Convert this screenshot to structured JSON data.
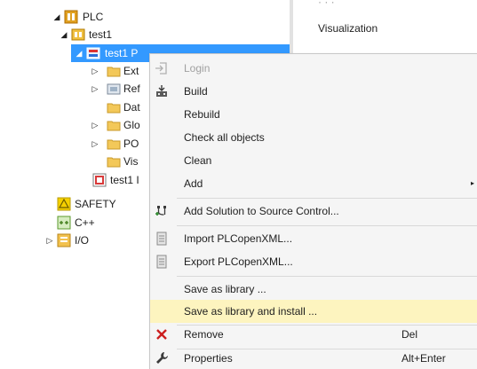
{
  "colors": {
    "selection": "#3399ff",
    "menu_background": "#f5f5f5",
    "menu_highlight": "#fdf4bf",
    "disabled_text": "#a0a0a0",
    "remove_icon": "#cc1f1f"
  },
  "tree": {
    "nodes": [
      {
        "label": "PLC",
        "icon": "plc-folder-icon",
        "expanded": true
      },
      {
        "label": "test1",
        "icon": "plc-project-icon",
        "expanded": true
      },
      {
        "label": "test1 P",
        "icon": "plc-project-node-icon",
        "expanded": true,
        "selected": true
      },
      {
        "label": "Ext",
        "icon": "folder-icon",
        "expanded": false
      },
      {
        "label": "Ref",
        "icon": "references-icon",
        "expanded": false
      },
      {
        "label": "Dat",
        "icon": "folder-icon"
      },
      {
        "label": "Glo",
        "icon": "folder-icon",
        "expanded": false
      },
      {
        "label": "PO",
        "icon": "folder-icon",
        "expanded": false
      },
      {
        "label": "Vis",
        "icon": "folder-icon"
      },
      {
        "label": "test1 I",
        "icon": "plc-instance-icon"
      },
      {
        "label": "SAFETY",
        "icon": "safety-icon"
      },
      {
        "label": "C++",
        "icon": "cpp-icon"
      },
      {
        "label": "I/O",
        "icon": "io-icon",
        "expanded": false
      }
    ]
  },
  "side_panel": {
    "items": [
      "Visualization"
    ]
  },
  "context_menu": {
    "items": [
      {
        "label": "Login",
        "icon": "login-icon",
        "disabled": true
      },
      {
        "label": "Build",
        "icon": "build-icon"
      },
      {
        "label": "Rebuild",
        "icon": ""
      },
      {
        "label": "Check all objects",
        "icon": ""
      },
      {
        "label": "Clean",
        "icon": ""
      },
      {
        "label": "Add",
        "icon": "",
        "submenu": true
      },
      {
        "label": "Add Solution to Source Control...",
        "icon": "source-control-icon"
      },
      {
        "label": "Import PLCopenXML...",
        "icon": "import-icon"
      },
      {
        "label": "Export PLCopenXML...",
        "icon": "export-icon"
      },
      {
        "label": "Save as library ...",
        "icon": ""
      },
      {
        "label": "Save as library and install ...",
        "icon": "",
        "highlighted": true
      },
      {
        "label": "Remove",
        "icon": "remove-icon",
        "shortcut": "Del"
      },
      {
        "label": "Properties",
        "icon": "wrench-icon",
        "shortcut": "Alt+Enter"
      }
    ],
    "submenu_arrow": "▸"
  }
}
